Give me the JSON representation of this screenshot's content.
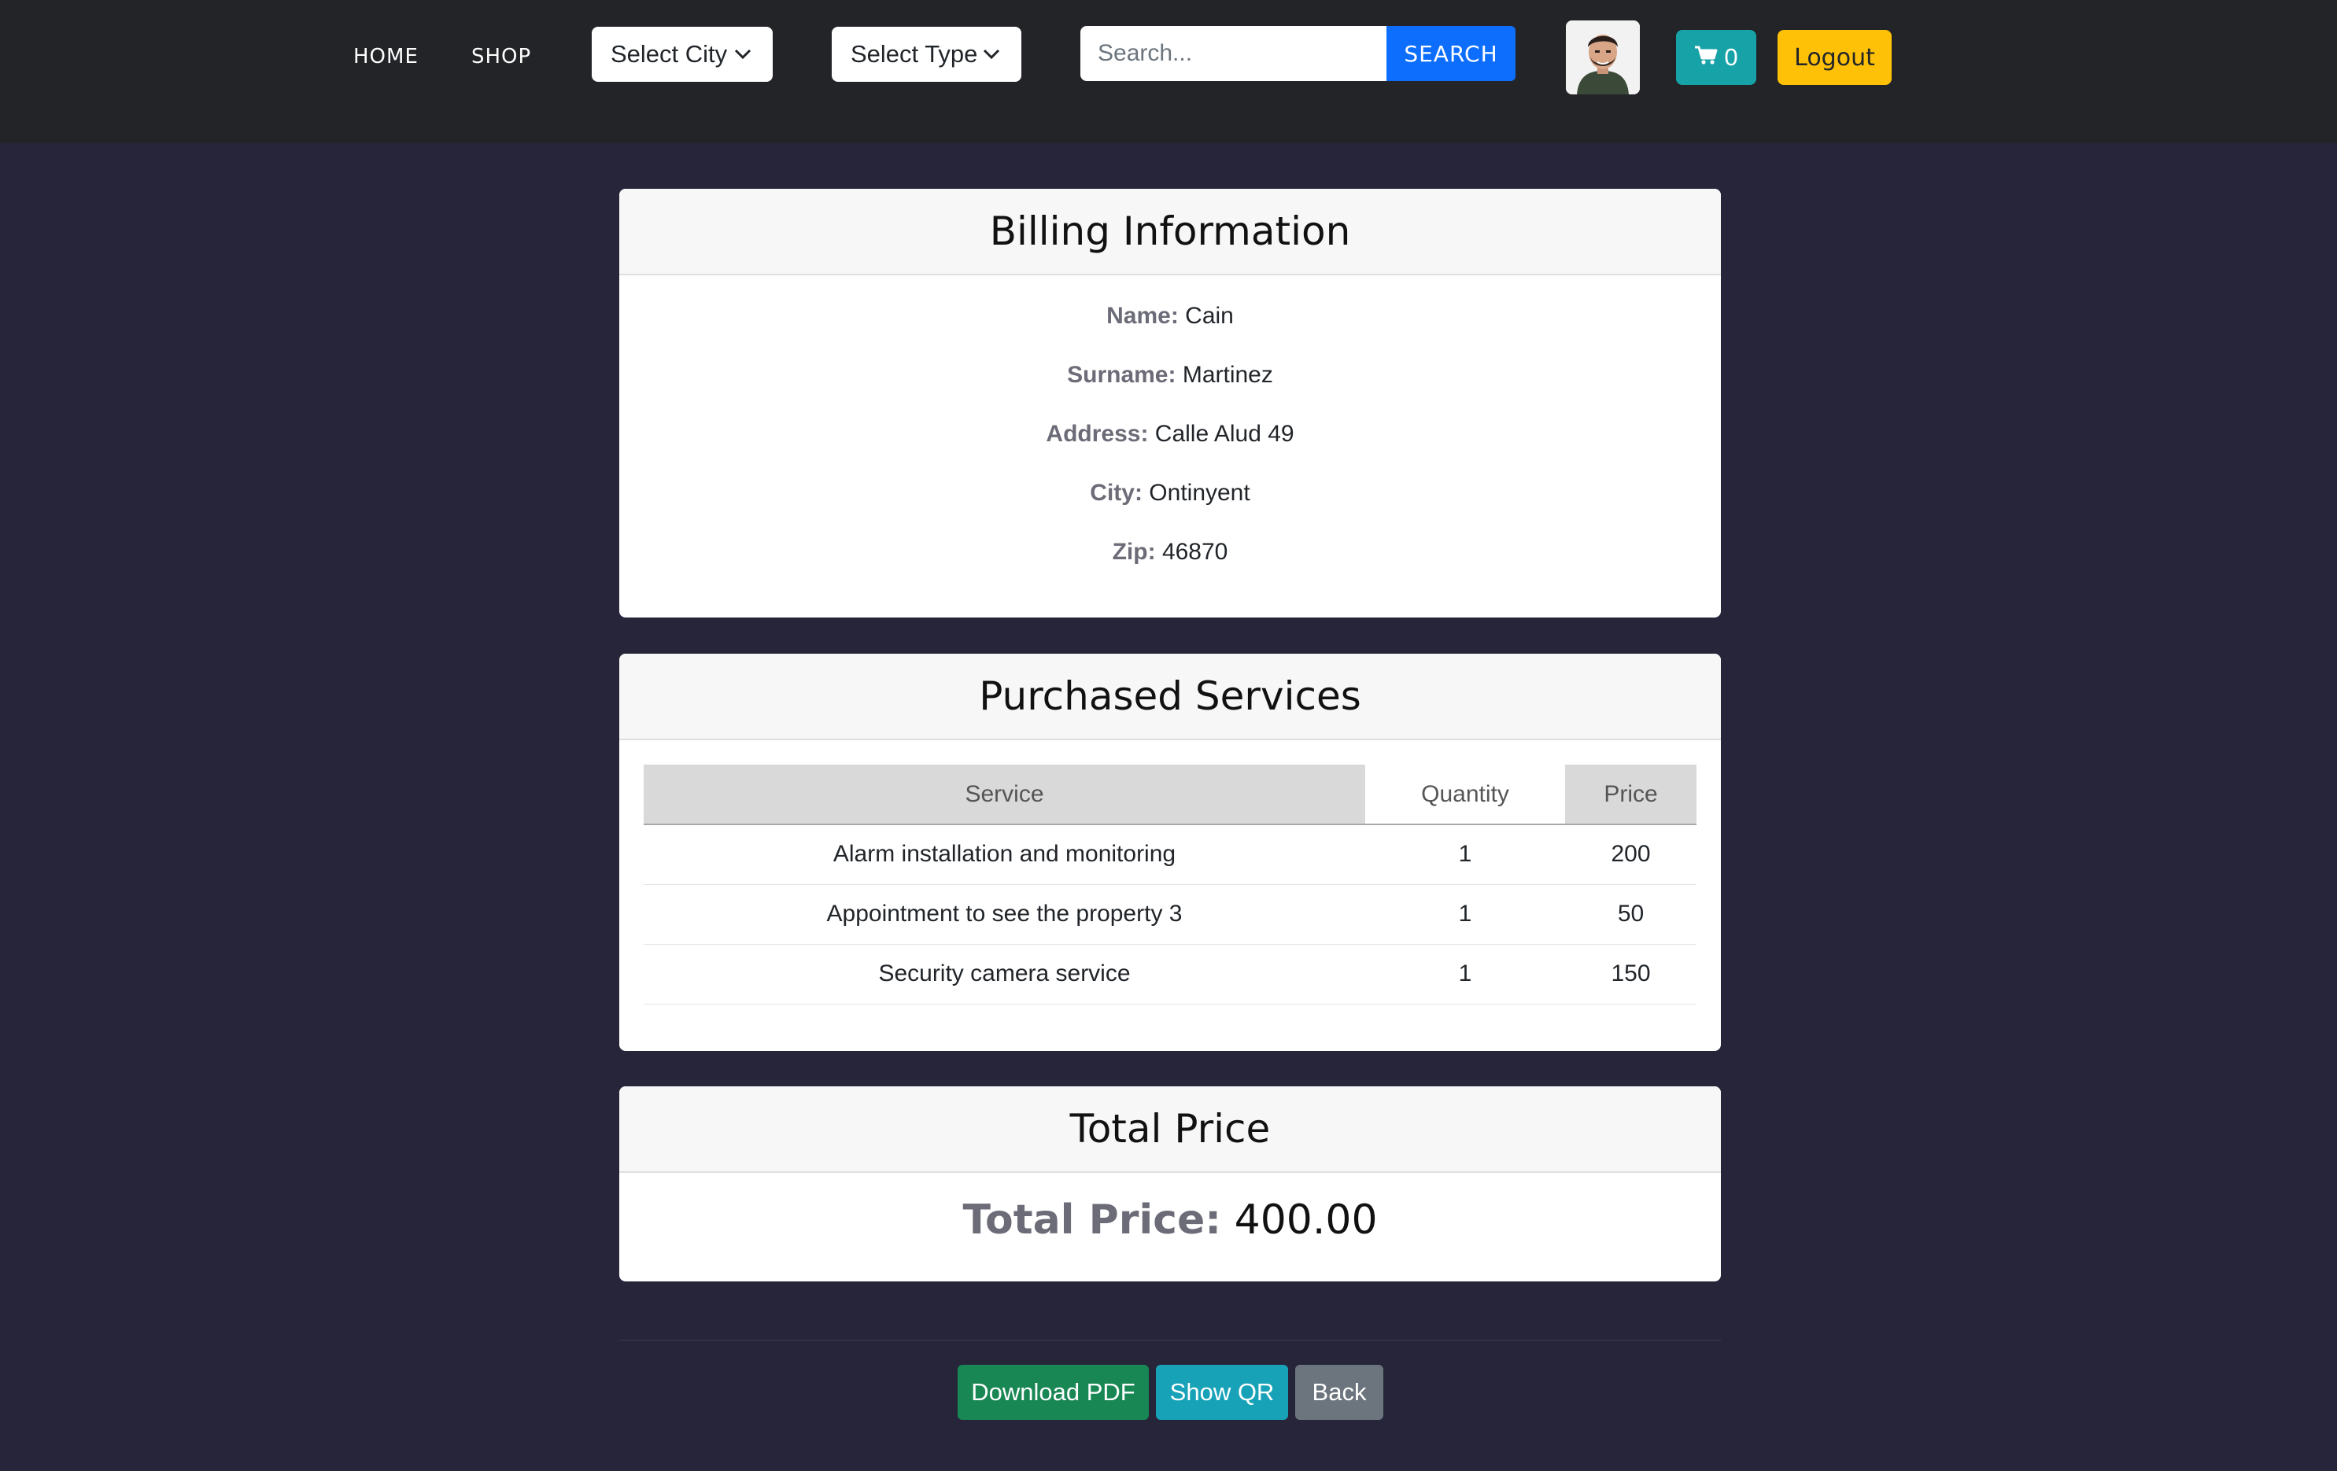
{
  "nav": {
    "home": "HOME",
    "shop": "SHOP",
    "city_select": "Select City",
    "type_select": "Select Type",
    "search_placeholder": "Search...",
    "search_button": "SEARCH",
    "cart_count": "0",
    "logout": "Logout"
  },
  "billing": {
    "title": "Billing Information",
    "rows": [
      {
        "label": "Name:",
        "value": "Cain"
      },
      {
        "label": "Surname:",
        "value": "Martinez"
      },
      {
        "label": "Address:",
        "value": "Calle Alud 49"
      },
      {
        "label": "City:",
        "value": "Ontinyent"
      },
      {
        "label": "Zip:",
        "value": "46870"
      }
    ]
  },
  "services": {
    "title": "Purchased Services",
    "headers": [
      "Service",
      "Quantity",
      "Price"
    ],
    "rows": [
      [
        "Alarm installation and monitoring",
        "1",
        "200"
      ],
      [
        "Appointment to see the property 3",
        "1",
        "50"
      ],
      [
        "Security camera service",
        "1",
        "150"
      ]
    ]
  },
  "total": {
    "title": "Total Price",
    "label": "Total Price:",
    "value": "400.00"
  },
  "actions": {
    "download": "Download PDF",
    "qr": "Show QR",
    "back": "Back"
  },
  "colors": {
    "navbar_bg": "#232427",
    "page_bg": "#26253a",
    "search_button": "#0d6efd",
    "cart_button": "#17a2a8",
    "logout_button": "#ffc107",
    "download_button": "#198754",
    "qr_button": "#17a2b8",
    "back_button": "#6c757d"
  },
  "icons": {
    "cart": "cart-icon",
    "chevron": "chevron-down-icon",
    "avatar": "user-avatar"
  }
}
